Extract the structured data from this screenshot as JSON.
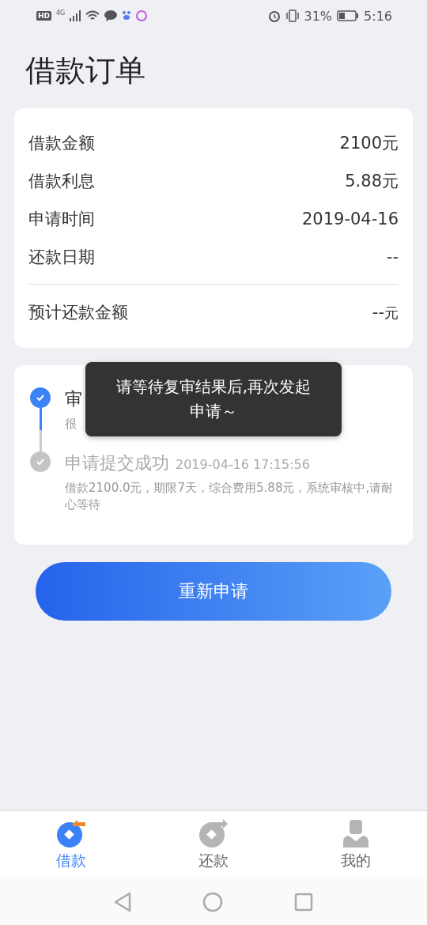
{
  "status_bar": {
    "hd": "HD",
    "network": "4G",
    "battery": "31%",
    "time": "5:16"
  },
  "title": "借款订单",
  "summary": {
    "rows": [
      {
        "label": "借款金额",
        "value": "2100元"
      },
      {
        "label": "借款利息",
        "value": "5.88元"
      },
      {
        "label": "申请时间",
        "value": "2019-04-16"
      },
      {
        "label": "还款日期",
        "value": "--"
      }
    ],
    "total": {
      "label": "预计还款金额",
      "value": "--",
      "unit": "元"
    }
  },
  "timeline": [
    {
      "title": "审",
      "desc": "很",
      "active": true
    },
    {
      "title": "申请提交成功",
      "time": "2019-04-16 17:15:56",
      "desc": "借款2100.0元，期限7天，综合费用5.88元，系统审核中,请耐心等待",
      "active": false
    }
  ],
  "toast": "请等待复审结果后,再次发起申请～",
  "button": "重新申请",
  "tabs": [
    {
      "label": "借款",
      "selected": true,
      "kind": "borrow"
    },
    {
      "label": "还款",
      "selected": false,
      "kind": "repay"
    },
    {
      "label": "我的",
      "selected": false,
      "kind": "me"
    }
  ]
}
